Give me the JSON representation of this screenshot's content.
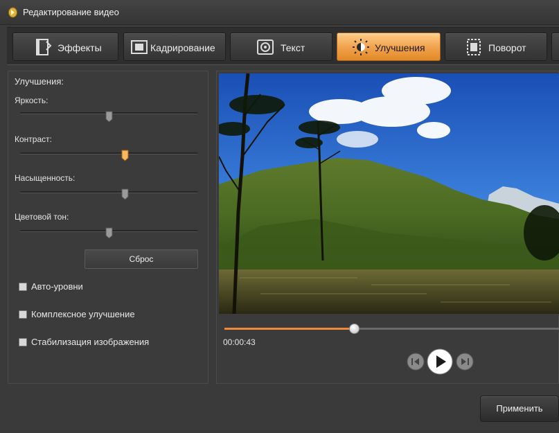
{
  "window": {
    "title": "Редактирование видео"
  },
  "tabs": [
    {
      "label": "Эффекты",
      "icon": "effects-icon",
      "active": false
    },
    {
      "label": "Кадрирование",
      "icon": "crop-icon",
      "active": false
    },
    {
      "label": "Текст",
      "icon": "text-icon",
      "active": false
    },
    {
      "label": "Улучшения",
      "icon": "enhance-icon",
      "active": true
    },
    {
      "label": "Поворот",
      "icon": "rotate-icon",
      "active": false
    }
  ],
  "enhance": {
    "heading": "Улучшения:",
    "sliders": [
      {
        "label": "Яркость:",
        "value": 0.5
      },
      {
        "label": "Контраст:",
        "value": 0.59
      },
      {
        "label": "Насыщенность:",
        "value": 0.59
      },
      {
        "label": "Цветовой тон:",
        "value": 0.5
      }
    ],
    "reset_label": "Сброс",
    "checkboxes": [
      {
        "label": "Авто-уровни",
        "checked": false
      },
      {
        "label": "Комплексное улучшение",
        "checked": false
      },
      {
        "label": "Стабилизация изображения",
        "checked": false
      }
    ]
  },
  "player": {
    "current_time": "00:00:43",
    "progress": 0.39
  },
  "apply_label": "Применить",
  "colors": {
    "accent": "#f0a04a",
    "progress": "#f08a3a",
    "background": "#3a3a3a"
  }
}
